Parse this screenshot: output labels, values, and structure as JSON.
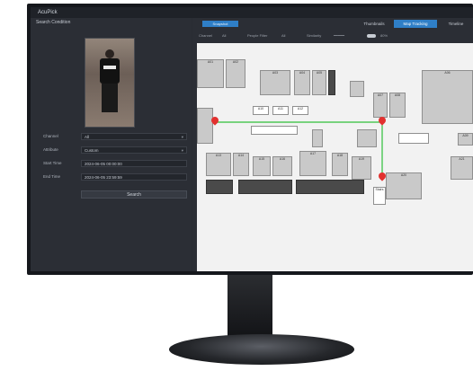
{
  "app": {
    "title": "AcuPick"
  },
  "left_panel": {
    "section_title": "Search Condition",
    "fields": [
      {
        "label": "Channel",
        "value": "All"
      },
      {
        "label": "Attribute",
        "value": "Custom"
      },
      {
        "label": "Start Time",
        "value": "2024-06-05  00:00:00"
      },
      {
        "label": "End Time",
        "value": "2024-06-05  23:59:59"
      }
    ],
    "search_button": "Search"
  },
  "right_panel": {
    "top_button": "Snapshot",
    "tabs": [
      {
        "label": "Thumbnails",
        "active": false
      },
      {
        "label": "Map Tracking",
        "active": true
      },
      {
        "label": "Timeline",
        "active": false
      }
    ],
    "toolbar": {
      "channel_label": "Channel",
      "channel_value": "All",
      "people_filter_label": "People Filter",
      "people_filter_value": "All",
      "similarity_label": "Similarity",
      "similarity_value": "80%"
    },
    "map": {
      "room_labels": [
        "A01",
        "A02",
        "A03",
        "A04",
        "A05",
        "A06",
        "A07",
        "A08",
        "A09",
        "A10",
        "A11",
        "A12",
        "A13",
        "A14",
        "A15",
        "A16",
        "A17",
        "A18",
        "A19",
        "A20",
        "A21",
        "A22",
        "Stairs"
      ],
      "track_color": "#2fbf3a",
      "pin_color": "#e2312f"
    }
  },
  "colors": {
    "accent": "#2f7fc7",
    "panel": "#2b2e35"
  }
}
